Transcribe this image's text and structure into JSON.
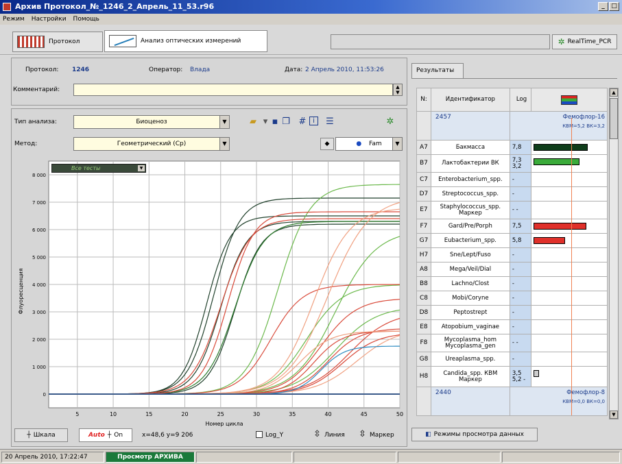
{
  "window": {
    "title": "Архив Протокол_№_1246_2_Апрель_11_53.r96",
    "controls": [
      "_",
      "□"
    ]
  },
  "menu": [
    "Режим",
    "Настройки",
    "Помощь"
  ],
  "tabs": [
    {
      "label": "Протокол"
    },
    {
      "label": "Анализ оптических измерений",
      "icon_text": "Ct="
    }
  ],
  "realtime_label": "RealTime_PCR",
  "protocol": {
    "label": "Протокол:",
    "value": "1246",
    "operator_label": "Оператор:",
    "operator": "Влада",
    "date_label": "Дата:",
    "date": "2 Апрель 2010, 11:53:26",
    "comment_label": "Комментарий:"
  },
  "analysis": {
    "type_label": "Тип анализа:",
    "type_value": "Биоценоз",
    "method_label": "Метод:",
    "method_value": "Геометрический (Cp)",
    "channel": "Fam"
  },
  "chart_data": {
    "type": "line",
    "dropdown": "Все тесты",
    "xlabel": "Номер цикла",
    "ylabel": "Флуоресценция",
    "xlim": [
      1,
      50
    ],
    "ylim": [
      -500,
      8500
    ],
    "xticks": [
      5,
      10,
      15,
      20,
      25,
      30,
      35,
      40,
      45,
      50
    ],
    "yticks": [
      0,
      1000,
      2000,
      3000,
      4000,
      5000,
      6000,
      7000,
      8000
    ],
    "ytick_labels": [
      "0",
      "1 000",
      "2 000",
      "3 000",
      "4 000",
      "5 000",
      "6 000",
      "7 000",
      "8 000"
    ],
    "series": [
      {
        "color": "#1f3f2a",
        "plateau": 7150,
        "mid": 24,
        "k": 0.55
      },
      {
        "color": "#1f3f2a",
        "plateau": 6500,
        "mid": 23,
        "k": 0.6
      },
      {
        "color": "#1f3f2a",
        "plateau": 6300,
        "mid": 25,
        "k": 0.55
      },
      {
        "color": "#1f3f2a",
        "plateau": 6200,
        "mid": 27,
        "k": 0.55
      },
      {
        "color": "#2a7a2a",
        "plateau": 6300,
        "mid": 27,
        "k": 0.5
      },
      {
        "color": "#6ab84a",
        "plateau": 7650,
        "mid": 33,
        "k": 0.45
      },
      {
        "color": "#6ab84a",
        "plateau": 6000,
        "mid": 41,
        "k": 0.35
      },
      {
        "color": "#6ab84a",
        "plateau": 4000,
        "mid": 37,
        "k": 0.4
      },
      {
        "color": "#6ab84a",
        "plateau": 3200,
        "mid": 41,
        "k": 0.35
      },
      {
        "color": "#d94a3a",
        "plateau": 6650,
        "mid": 26,
        "k": 0.55
      },
      {
        "color": "#d94a3a",
        "plateau": 6400,
        "mid": 25,
        "k": 0.5
      },
      {
        "color": "#d94a3a",
        "plateau": 4000,
        "mid": 32,
        "k": 0.45
      },
      {
        "color": "#d94a3a",
        "plateau": 3500,
        "mid": 39,
        "k": 0.4
      },
      {
        "color": "#d94a3a",
        "plateau": 3000,
        "mid": 43,
        "k": 0.35
      },
      {
        "color": "#d94a3a",
        "plateau": 2400,
        "mid": 40,
        "k": 0.45
      },
      {
        "color": "#d94a3a",
        "plateau": 2250,
        "mid": 42,
        "k": 0.4
      },
      {
        "color": "#d94a3a",
        "plateau": 2300,
        "mid": 38,
        "k": 0.5
      },
      {
        "color": "#f0a080",
        "plateau": 7200,
        "mid": 40,
        "k": 0.35
      },
      {
        "color": "#f0a080",
        "plateau": 6800,
        "mid": 38,
        "k": 0.4
      },
      {
        "color": "#f0a080",
        "plateau": 2400,
        "mid": 44,
        "k": 0.35
      },
      {
        "color": "#f0a080",
        "plateau": 2300,
        "mid": 36,
        "k": 0.45
      },
      {
        "color": "#2a8ac0",
        "plateau": 1750,
        "mid": 39,
        "k": 0.6
      }
    ]
  },
  "bottom": {
    "scale_label": "Шкала",
    "auto_label": "Auto",
    "on_label": "On",
    "coords": "x=48,6 y=9 206",
    "logy_label": "Log_Y",
    "line_label": "Линия",
    "marker_label": "Маркер"
  },
  "results": {
    "tab_label": "Результаты",
    "headers": {
      "n": "N:",
      "id": "Идентификатор",
      "log": "Log"
    },
    "group1": {
      "id": "2457",
      "name": "Фемофлор-16",
      "sub": "КВМ=5,2  ВК=3,2"
    },
    "rows": [
      {
        "n": "A7",
        "name": "Бакмасса",
        "log": "7,8",
        "bar": 0.82,
        "color": "#0f3d1a"
      },
      {
        "n": "B7",
        "name": "Лактобактерии ВК",
        "log": "7,3 3,2",
        "bar": 0.7,
        "color": "#3aab3a"
      },
      {
        "n": "C7",
        "name": "Enterobacterium_spp.",
        "log": "-",
        "bar": 0,
        "color": ""
      },
      {
        "n": "D7",
        "name": "Streptococcus_spp.",
        "log": "-",
        "bar": 0,
        "color": ""
      },
      {
        "n": "E7",
        "name": "Staphylococcus_spp. Маркер",
        "log": "- -",
        "bar": 0,
        "color": ""
      },
      {
        "n": "F7",
        "name": "Gard/Pre/Porph",
        "log": "7,5",
        "bar": 0.8,
        "color": "#e0302a"
      },
      {
        "n": "G7",
        "name": "Eubacterium_spp.",
        "log": "5,8",
        "bar": 0.48,
        "color": "#e0302a"
      },
      {
        "n": "H7",
        "name": "Sne/Lept/Fuso",
        "log": "-",
        "bar": 0,
        "color": ""
      },
      {
        "n": "A8",
        "name": "Mega/Veil/Dial",
        "log": "-",
        "bar": 0,
        "color": ""
      },
      {
        "n": "B8",
        "name": "Lachno/Clost",
        "log": "-",
        "bar": 0,
        "color": ""
      },
      {
        "n": "C8",
        "name": "Mobi/Coryne",
        "log": "-",
        "bar": 0,
        "color": ""
      },
      {
        "n": "D8",
        "name": "Peptostrept",
        "log": "-",
        "bar": 0,
        "color": ""
      },
      {
        "n": "E8",
        "name": "Atopobium_vaginae",
        "log": "-",
        "bar": 0,
        "color": ""
      },
      {
        "n": "F8",
        "name": "Mycoplasma_hom Mycoplasma_gen",
        "log": "- -",
        "bar": 0,
        "color": ""
      },
      {
        "n": "G8",
        "name": "Ureaplasma_spp.",
        "log": "-",
        "bar": 0,
        "color": ""
      },
      {
        "n": "H8",
        "name": "Candida_spp. КВМ Маркер",
        "log": "3,5 5,2 -",
        "bar": 0.06,
        "color": "#cccccc"
      }
    ],
    "group2": {
      "id": "2440",
      "name": "Фемофлор-8",
      "sub": "КВМ=0,0  ВК=0,0"
    },
    "view_modes": "Режимы просмотра данных"
  },
  "status": {
    "datetime": "20 Апрель 2010, 17:22:47",
    "mode": "Просмотр АРХИВА"
  }
}
